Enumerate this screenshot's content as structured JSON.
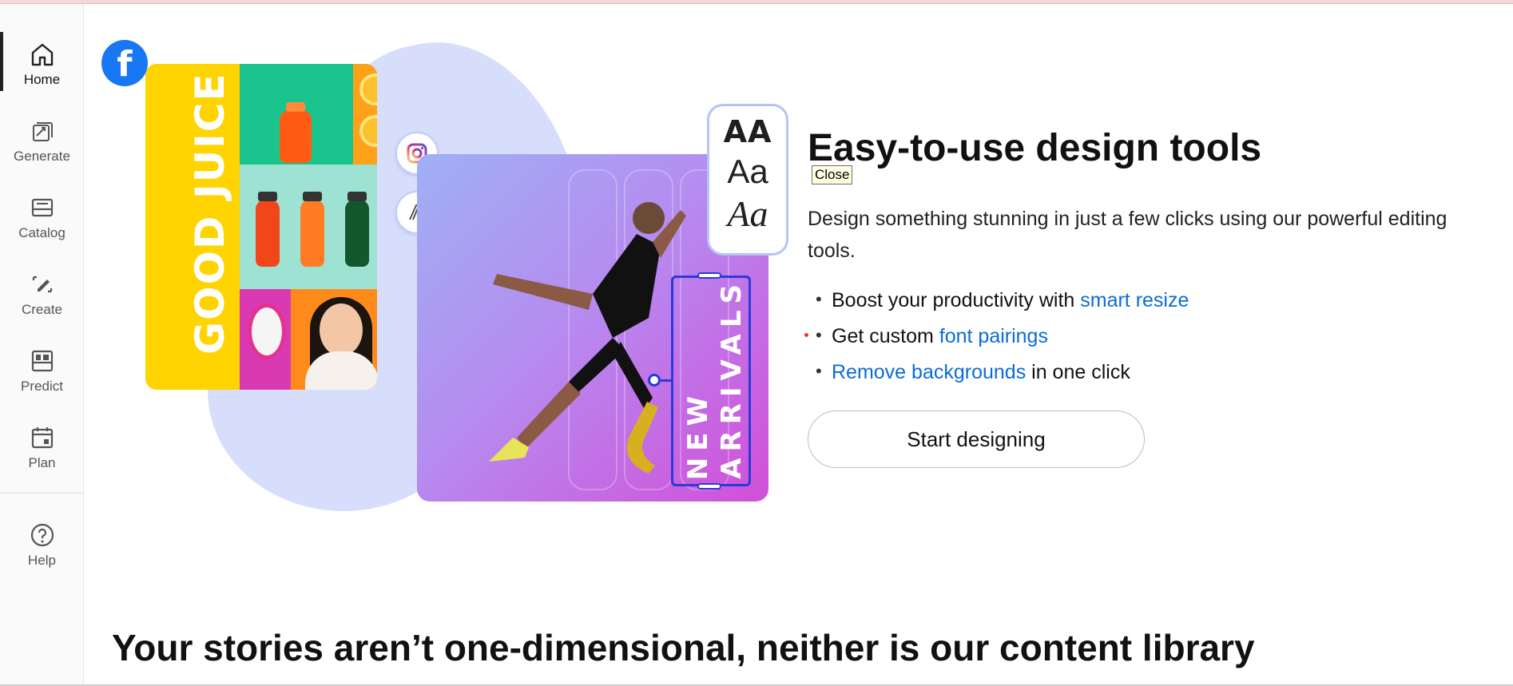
{
  "sidebar": {
    "items": [
      {
        "label": "Home",
        "icon": "home-icon",
        "active": true
      },
      {
        "label": "Generate",
        "icon": "generate-icon"
      },
      {
        "label": "Catalog",
        "icon": "catalog-icon"
      },
      {
        "label": "Create",
        "icon": "create-icon"
      },
      {
        "label": "Predict",
        "icon": "predict-icon"
      },
      {
        "label": "Plan",
        "icon": "calendar-icon"
      }
    ],
    "help": {
      "label": "Help",
      "icon": "help-icon"
    }
  },
  "hero": {
    "juice_card_text": "GOOD JUICE",
    "font_samples": [
      "AA",
      "Aa",
      "Aa"
    ],
    "vertical_text": [
      "NEW",
      "ARRIVALS"
    ],
    "icons": [
      "facebook-icon",
      "instagram-icon",
      "adobe-express-icon"
    ]
  },
  "tooltip": {
    "close_label": "Close"
  },
  "feature": {
    "title": "Easy-to-use design tools",
    "description": "Design something stunning in just a few clicks using our powerful editing tools.",
    "bullets": [
      {
        "before": "Boost your productivity with ",
        "link": "smart resize",
        "after": ""
      },
      {
        "before": "Get custom ",
        "link": "font pairings",
        "after": ""
      },
      {
        "before": "",
        "link": "Remove backgrounds",
        "after": " in one click"
      }
    ],
    "bullet_glyph": "•",
    "cta_label": "Start designing"
  },
  "section": {
    "title": "Your stories aren’t one-dimensional, neither is our content library"
  },
  "colors": {
    "link": "#0a6cd6",
    "facebook": "#1877f2",
    "accent_blue": "#2a3adb"
  }
}
